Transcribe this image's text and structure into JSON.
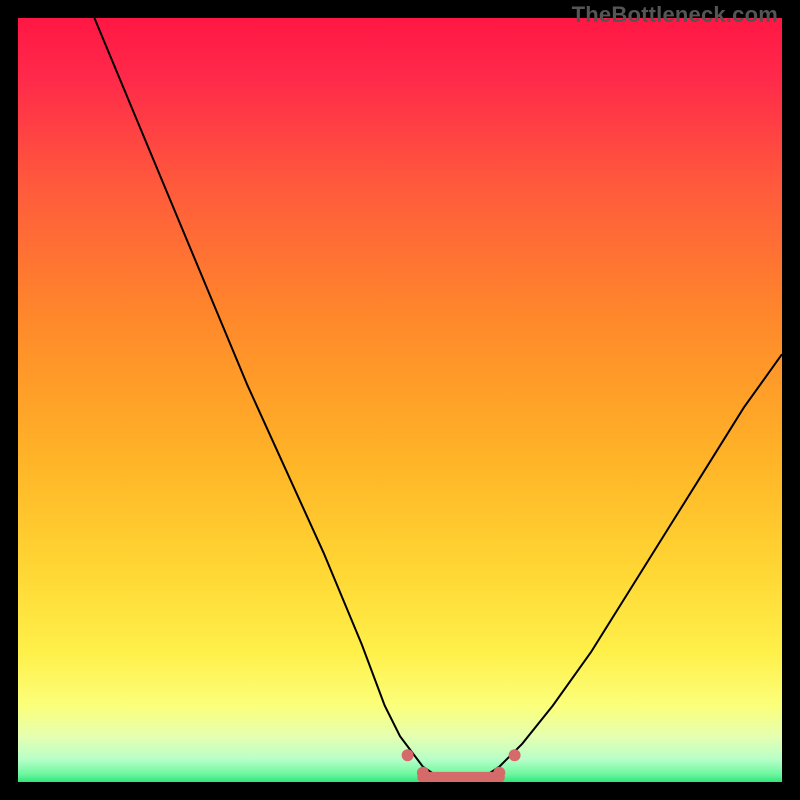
{
  "watermark": "TheBottleneck.com",
  "colors": {
    "curve": "#000000",
    "highlight": "#d46a6a",
    "gradient_top": "#ff1744",
    "gradient_bottom": "#2ee57e"
  },
  "chart_data": {
    "type": "line",
    "title": "",
    "xlabel": "",
    "ylabel": "",
    "xlim": [
      0,
      100
    ],
    "ylim": [
      0,
      100
    ],
    "x": [
      10,
      15,
      20,
      25,
      30,
      35,
      40,
      45,
      48,
      50,
      53,
      56,
      58,
      60,
      63,
      66,
      70,
      75,
      80,
      85,
      90,
      95,
      100
    ],
    "values": [
      100,
      88,
      76,
      64,
      52,
      41,
      30,
      18,
      10,
      6,
      2,
      0,
      0,
      0,
      2,
      5,
      10,
      17,
      25,
      33,
      41,
      49,
      56
    ],
    "flat_region_x": [
      53,
      63
    ],
    "annotations": []
  }
}
